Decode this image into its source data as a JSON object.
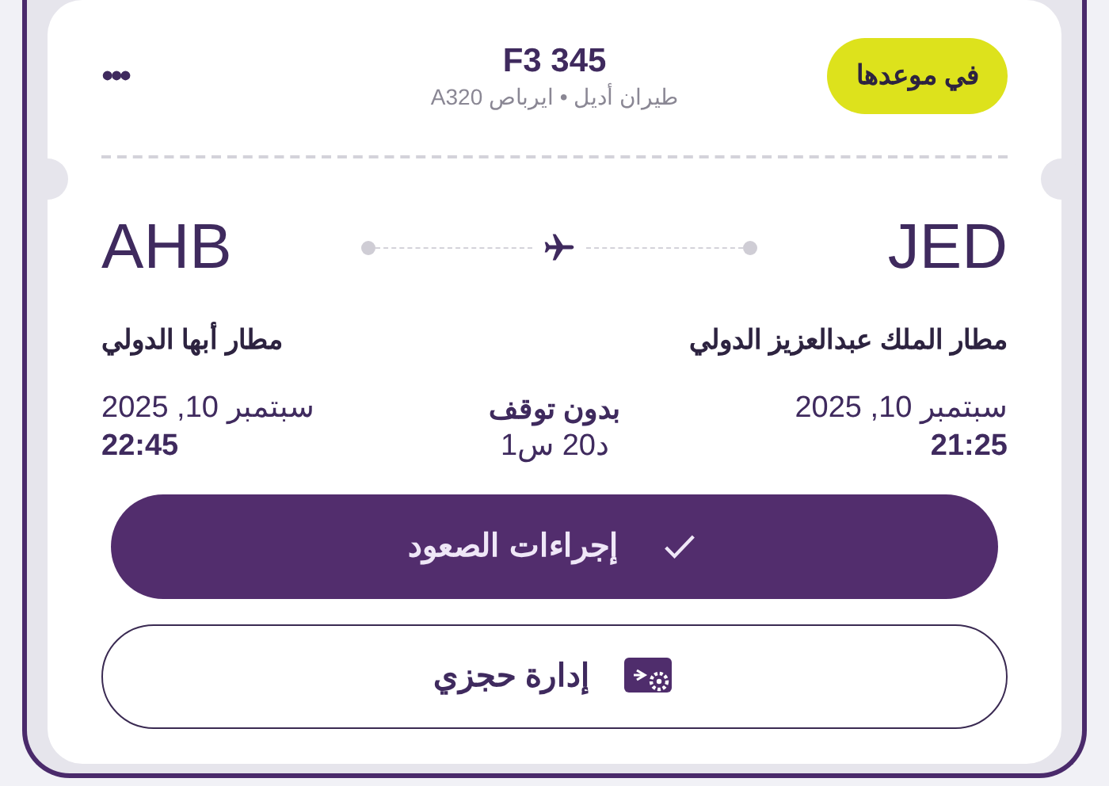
{
  "flight": {
    "status": "في موعدها",
    "number": "F3 345",
    "details": "طيران أديل • ايرباص A320",
    "menu": "•••"
  },
  "origin": {
    "code": "JED",
    "airport": "مطار الملك عبدالعزيز الدولي",
    "date": "سبتمبر 10, 2025",
    "time": "21:25"
  },
  "destination": {
    "code": "AHB",
    "airport": "مطار أبها الدولي",
    "date": "سبتمبر 10, 2025",
    "time": "22:45"
  },
  "duration": {
    "stops": "بدون توقف",
    "time": "1س 20د"
  },
  "buttons": [
    {
      "label": "إجراءات الصعود",
      "kind": "primary"
    },
    {
      "label": "إدارة حجزي",
      "kind": "outline"
    }
  ]
}
